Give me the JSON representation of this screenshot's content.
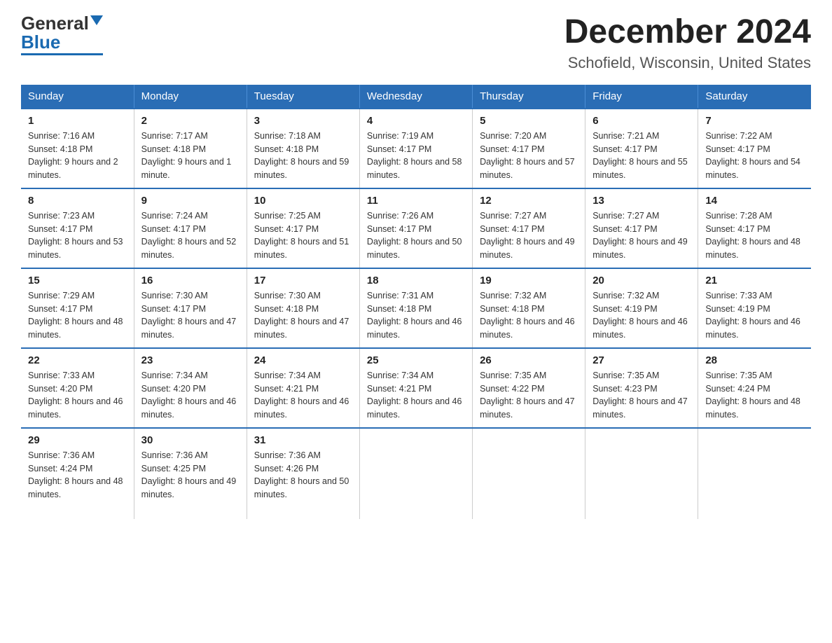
{
  "logo": {
    "general": "General",
    "blue": "Blue"
  },
  "title": {
    "month": "December 2024",
    "location": "Schofield, Wisconsin, United States"
  },
  "headers": [
    "Sunday",
    "Monday",
    "Tuesday",
    "Wednesday",
    "Thursday",
    "Friday",
    "Saturday"
  ],
  "weeks": [
    [
      {
        "day": "1",
        "sunrise": "7:16 AM",
        "sunset": "4:18 PM",
        "daylight": "9 hours and 2 minutes."
      },
      {
        "day": "2",
        "sunrise": "7:17 AM",
        "sunset": "4:18 PM",
        "daylight": "9 hours and 1 minute."
      },
      {
        "day": "3",
        "sunrise": "7:18 AM",
        "sunset": "4:18 PM",
        "daylight": "8 hours and 59 minutes."
      },
      {
        "day": "4",
        "sunrise": "7:19 AM",
        "sunset": "4:17 PM",
        "daylight": "8 hours and 58 minutes."
      },
      {
        "day": "5",
        "sunrise": "7:20 AM",
        "sunset": "4:17 PM",
        "daylight": "8 hours and 57 minutes."
      },
      {
        "day": "6",
        "sunrise": "7:21 AM",
        "sunset": "4:17 PM",
        "daylight": "8 hours and 55 minutes."
      },
      {
        "day": "7",
        "sunrise": "7:22 AM",
        "sunset": "4:17 PM",
        "daylight": "8 hours and 54 minutes."
      }
    ],
    [
      {
        "day": "8",
        "sunrise": "7:23 AM",
        "sunset": "4:17 PM",
        "daylight": "8 hours and 53 minutes."
      },
      {
        "day": "9",
        "sunrise": "7:24 AM",
        "sunset": "4:17 PM",
        "daylight": "8 hours and 52 minutes."
      },
      {
        "day": "10",
        "sunrise": "7:25 AM",
        "sunset": "4:17 PM",
        "daylight": "8 hours and 51 minutes."
      },
      {
        "day": "11",
        "sunrise": "7:26 AM",
        "sunset": "4:17 PM",
        "daylight": "8 hours and 50 minutes."
      },
      {
        "day": "12",
        "sunrise": "7:27 AM",
        "sunset": "4:17 PM",
        "daylight": "8 hours and 49 minutes."
      },
      {
        "day": "13",
        "sunrise": "7:27 AM",
        "sunset": "4:17 PM",
        "daylight": "8 hours and 49 minutes."
      },
      {
        "day": "14",
        "sunrise": "7:28 AM",
        "sunset": "4:17 PM",
        "daylight": "8 hours and 48 minutes."
      }
    ],
    [
      {
        "day": "15",
        "sunrise": "7:29 AM",
        "sunset": "4:17 PM",
        "daylight": "8 hours and 48 minutes."
      },
      {
        "day": "16",
        "sunrise": "7:30 AM",
        "sunset": "4:17 PM",
        "daylight": "8 hours and 47 minutes."
      },
      {
        "day": "17",
        "sunrise": "7:30 AM",
        "sunset": "4:18 PM",
        "daylight": "8 hours and 47 minutes."
      },
      {
        "day": "18",
        "sunrise": "7:31 AM",
        "sunset": "4:18 PM",
        "daylight": "8 hours and 46 minutes."
      },
      {
        "day": "19",
        "sunrise": "7:32 AM",
        "sunset": "4:18 PM",
        "daylight": "8 hours and 46 minutes."
      },
      {
        "day": "20",
        "sunrise": "7:32 AM",
        "sunset": "4:19 PM",
        "daylight": "8 hours and 46 minutes."
      },
      {
        "day": "21",
        "sunrise": "7:33 AM",
        "sunset": "4:19 PM",
        "daylight": "8 hours and 46 minutes."
      }
    ],
    [
      {
        "day": "22",
        "sunrise": "7:33 AM",
        "sunset": "4:20 PM",
        "daylight": "8 hours and 46 minutes."
      },
      {
        "day": "23",
        "sunrise": "7:34 AM",
        "sunset": "4:20 PM",
        "daylight": "8 hours and 46 minutes."
      },
      {
        "day": "24",
        "sunrise": "7:34 AM",
        "sunset": "4:21 PM",
        "daylight": "8 hours and 46 minutes."
      },
      {
        "day": "25",
        "sunrise": "7:34 AM",
        "sunset": "4:21 PM",
        "daylight": "8 hours and 46 minutes."
      },
      {
        "day": "26",
        "sunrise": "7:35 AM",
        "sunset": "4:22 PM",
        "daylight": "8 hours and 47 minutes."
      },
      {
        "day": "27",
        "sunrise": "7:35 AM",
        "sunset": "4:23 PM",
        "daylight": "8 hours and 47 minutes."
      },
      {
        "day": "28",
        "sunrise": "7:35 AM",
        "sunset": "4:24 PM",
        "daylight": "8 hours and 48 minutes."
      }
    ],
    [
      {
        "day": "29",
        "sunrise": "7:36 AM",
        "sunset": "4:24 PM",
        "daylight": "8 hours and 48 minutes."
      },
      {
        "day": "30",
        "sunrise": "7:36 AM",
        "sunset": "4:25 PM",
        "daylight": "8 hours and 49 minutes."
      },
      {
        "day": "31",
        "sunrise": "7:36 AM",
        "sunset": "4:26 PM",
        "daylight": "8 hours and 50 minutes."
      },
      null,
      null,
      null,
      null
    ]
  ]
}
